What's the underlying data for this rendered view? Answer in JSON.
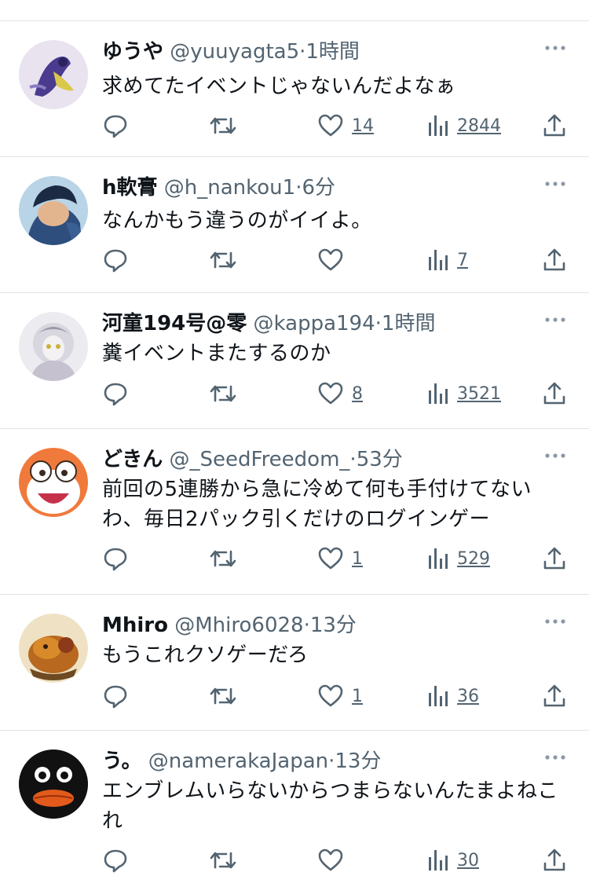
{
  "tweets": [
    {
      "name": "ゆうや",
      "handle": "@yuuyagta5",
      "time": "1時間",
      "text": "求めてたイベントじゃないんだよなぁ",
      "likes": "14",
      "views": "2844"
    },
    {
      "name": "h軟膏",
      "handle": "@h_nankou1",
      "time": "6分",
      "text": "なんかもう違うのがイイよ。",
      "likes": "",
      "views": "7"
    },
    {
      "name": "河童194号@零",
      "handle": "@kappa194",
      "time": "1時間",
      "text": "糞イベントまたするのか",
      "likes": "8",
      "views": "3521"
    },
    {
      "name": "どきん",
      "handle": "@_SeedFreedom_",
      "time": "53分",
      "text": "前回の5連勝から急に冷めて何も手付けてないわ、毎日2パック引くだけのログインゲー",
      "likes": "1",
      "views": "529"
    },
    {
      "name": "Mhiro",
      "handle": "@Mhiro6028",
      "time": "13分",
      "text": "もうこれクソゲーだろ",
      "likes": "1",
      "views": "36"
    },
    {
      "name": "う。",
      "handle": "@namerakaJapan",
      "time": "13分",
      "text": "エンブレムいらないからつまらないんたまよねこれ",
      "likes": "",
      "views": "30"
    }
  ],
  "separator": "·",
  "colors": {
    "text": "#0f1419",
    "muted": "#536471",
    "border": "#e1e4e8"
  }
}
